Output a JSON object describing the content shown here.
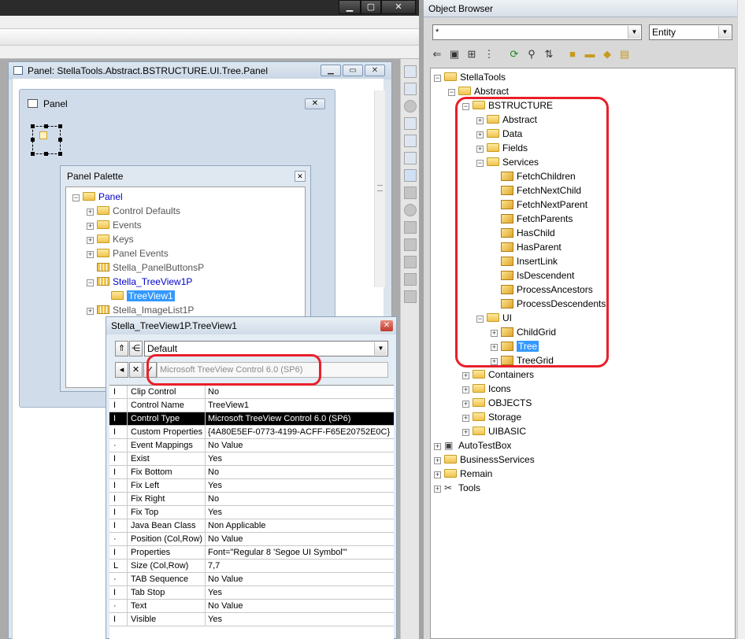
{
  "panel_window": {
    "title": "Panel: StellaTools.Abstract.BSTRUCTURE.UI.Tree.Panel"
  },
  "form": {
    "title": "Panel"
  },
  "palette": {
    "title": "Panel Palette",
    "items": [
      {
        "label": "Panel",
        "type": "folder"
      },
      {
        "label": "Control Defaults",
        "type": "folder"
      },
      {
        "label": "Events",
        "type": "folder"
      },
      {
        "label": "Keys",
        "type": "folder"
      },
      {
        "label": "Panel Events",
        "type": "folder"
      },
      {
        "label": "Stella_PanelButtonsP",
        "type": "control"
      },
      {
        "label": "Stella_TreeView1P",
        "type": "control"
      },
      {
        "label": "TreeView1",
        "type": "folder",
        "selected": true
      },
      {
        "label": "Stella_ImageList1P",
        "type": "control"
      }
    ]
  },
  "props": {
    "title": "Stella_TreeView1P.TreeView1",
    "select_value": "Default",
    "value_field": "Microsoft TreeView Control 6.0 (SP6)",
    "rows": [
      {
        "mark": "I",
        "name": "Clip Control",
        "value": "No"
      },
      {
        "mark": "I",
        "name": "Control Name",
        "value": "TreeView1"
      },
      {
        "mark": "I",
        "name": "Control Type",
        "value": "Microsoft TreeView Control 6.0 (SP6)",
        "selected": true
      },
      {
        "mark": "I",
        "name": "Custom Properties",
        "value": "{4A80E5EF-0773-4199-ACFF-F65E20752E0C}"
      },
      {
        "mark": "·",
        "name": "Event Mappings",
        "value": "No Value"
      },
      {
        "mark": "I",
        "name": "Exist",
        "value": "Yes"
      },
      {
        "mark": "I",
        "name": "Fix Bottom",
        "value": "No"
      },
      {
        "mark": "I",
        "name": "Fix Left",
        "value": "Yes"
      },
      {
        "mark": "I",
        "name": "Fix Right",
        "value": "No"
      },
      {
        "mark": "I",
        "name": "Fix Top",
        "value": "Yes"
      },
      {
        "mark": "I",
        "name": "Java Bean Class",
        "value": "Non Applicable"
      },
      {
        "mark": "·",
        "name": "Position (Col,Row)",
        "value": "No Value"
      },
      {
        "mark": "I",
        "name": "Properties",
        "value": "Font=\"Regular 8 'Segoe UI Symbol'\""
      },
      {
        "mark": "L",
        "name": "Size (Col,Row)",
        "value": "7,7"
      },
      {
        "mark": "·",
        "name": "TAB Sequence",
        "value": "No Value"
      },
      {
        "mark": "I",
        "name": "Tab Stop",
        "value": "Yes"
      },
      {
        "mark": "·",
        "name": "Text",
        "value": "No Value"
      },
      {
        "mark": "I",
        "name": "Visible",
        "value": "Yes"
      }
    ]
  },
  "object_browser": {
    "title": "Object Browser",
    "filter_value": "*",
    "entity_value": "Entity",
    "tree": [
      {
        "label": "StellaTools",
        "icon": "folder"
      },
      {
        "label": "Abstract",
        "icon": "folder"
      },
      {
        "label": "BSTRUCTURE",
        "icon": "folder"
      },
      {
        "label": "Abstract",
        "icon": "folder"
      },
      {
        "label": "Data",
        "icon": "folder"
      },
      {
        "label": "Fields",
        "icon": "folder"
      },
      {
        "label": "Services",
        "icon": "folder"
      },
      {
        "label": "FetchChildren",
        "icon": "class"
      },
      {
        "label": "FetchNextChild",
        "icon": "class"
      },
      {
        "label": "FetchNextParent",
        "icon": "class"
      },
      {
        "label": "FetchParents",
        "icon": "class"
      },
      {
        "label": "HasChild",
        "icon": "class"
      },
      {
        "label": "HasParent",
        "icon": "class"
      },
      {
        "label": "InsertLink",
        "icon": "class"
      },
      {
        "label": "IsDescendent",
        "icon": "class"
      },
      {
        "label": "ProcessAncestors",
        "icon": "class"
      },
      {
        "label": "ProcessDescendents",
        "icon": "class"
      },
      {
        "label": "UI",
        "icon": "folder"
      },
      {
        "label": "ChildGrid",
        "icon": "class"
      },
      {
        "label": "Tree",
        "icon": "class",
        "selected": true
      },
      {
        "label": "TreeGrid",
        "icon": "class"
      },
      {
        "label": "Containers",
        "icon": "folder"
      },
      {
        "label": "Icons",
        "icon": "folder"
      },
      {
        "label": "OBJECTS",
        "icon": "folder"
      },
      {
        "label": "Storage",
        "icon": "folder"
      },
      {
        "label": "UIBASIC",
        "icon": "folder"
      },
      {
        "label": "AutoTestBox",
        "icon": "package"
      },
      {
        "label": "BusinessServices",
        "icon": "folder"
      },
      {
        "label": "Remain",
        "icon": "folder"
      },
      {
        "label": "Tools",
        "icon": "tools"
      }
    ]
  },
  "colors": {
    "highlight_red": "#e8202a",
    "selection_blue": "#3399ff",
    "tree_label_blue": "#0000cc"
  }
}
